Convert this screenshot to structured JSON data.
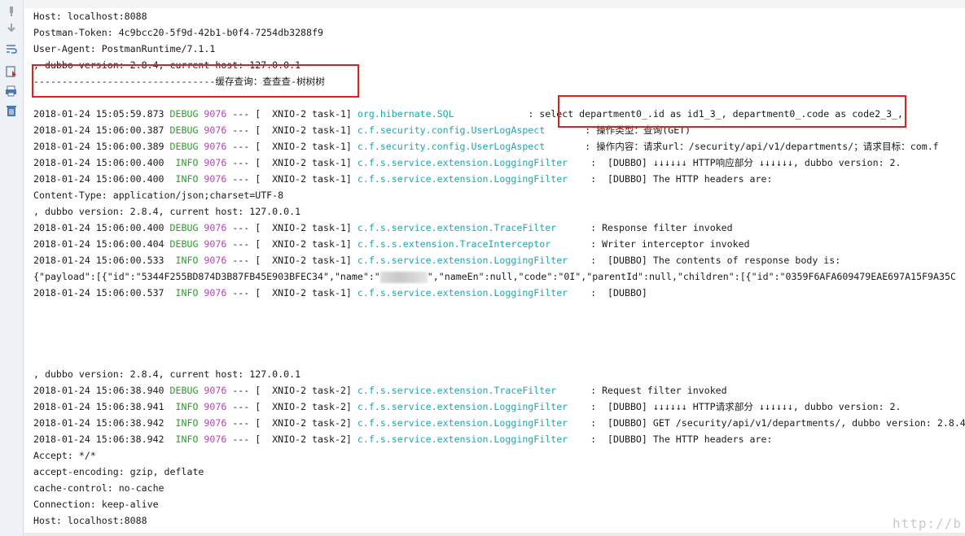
{
  "toolbar": {
    "icons": [
      "pin-icon",
      "down-arrow-icon",
      "soft-wrap-icon",
      "scroll-to-end-icon",
      "print-icon",
      "clear-icon"
    ]
  },
  "lines": [
    {
      "text": "Host: localhost:8088"
    },
    {
      "text": "Postman-Token: 4c9bcc20-5f9d-42b1-b0f4-7254db3288f9"
    },
    {
      "text": "User-Agent: PostmanRuntime/7.1.1"
    },
    {
      "text": ", dubbo version: 2.8.4, current host: 127.0.0.1"
    },
    {
      "text": "--------------------------------缓存查询：查查查-树树树"
    },
    {
      "text": ""
    },
    {
      "ts": "2018-01-24 15:05:59.873",
      "level": "DEBUG",
      "pid": "9076",
      "thread": "--- [  XNIO-2 task-1]",
      "logger": "org.hibernate.SQL",
      "pad": "             ",
      "msg": ": select department0_.id as id1_3_, department0_.code as code2_3_,"
    },
    {
      "ts": "2018-01-24 15:06:00.387",
      "level": "DEBUG",
      "pid": "9076",
      "thread": "--- [  XNIO-2 task-1]",
      "logger": "c.f.security.config.UserLogAspect",
      "pad": "       ",
      "msg": ": 操作类型：查询(GET)"
    },
    {
      "ts": "2018-01-24 15:06:00.389",
      "level": "DEBUG",
      "pid": "9076",
      "thread": "--- [  XNIO-2 task-1]",
      "logger": "c.f.security.config.UserLogAspect",
      "pad": "       ",
      "msg": ": 操作内容：请求url：/security/api/v1/departments/；请求目标：com.f"
    },
    {
      "ts": "2018-01-24 15:06:00.400",
      "level": " INFO",
      "pid": "9076",
      "thread": "--- [  XNIO-2 task-1]",
      "logger": "c.f.s.service.extension.LoggingFilter",
      "pad": "    ",
      "msg": ":  [DUBBO] ↓↓↓↓↓↓ HTTP响应部分 ↓↓↓↓↓↓, dubbo version: 2."
    },
    {
      "ts": "2018-01-24 15:06:00.400",
      "level": " INFO",
      "pid": "9076",
      "thread": "--- [  XNIO-2 task-1]",
      "logger": "c.f.s.service.extension.LoggingFilter",
      "pad": "    ",
      "msg": ":  [DUBBO] The HTTP headers are:"
    },
    {
      "text": "Content-Type: application/json;charset=UTF-8"
    },
    {
      "text": ", dubbo version: 2.8.4, current host: 127.0.0.1"
    },
    {
      "ts": "2018-01-24 15:06:00.400",
      "level": "DEBUG",
      "pid": "9076",
      "thread": "--- [  XNIO-2 task-1]",
      "logger": "c.f.s.service.extension.TraceFilter",
      "pad": "      ",
      "msg": ": Response filter invoked"
    },
    {
      "ts": "2018-01-24 15:06:00.404",
      "level": "DEBUG",
      "pid": "9076",
      "thread": "--- [  XNIO-2 task-1]",
      "logger": "c.f.s.s.extension.TraceInterceptor",
      "pad": "       ",
      "msg": ": Writer interceptor invoked"
    },
    {
      "ts": "2018-01-24 15:06:00.533",
      "level": " INFO",
      "pid": "9076",
      "thread": "--- [  XNIO-2 task-1]",
      "logger": "c.f.s.service.extension.LoggingFilter",
      "pad": "    ",
      "msg": ":  [DUBBO] The contents of response body is:"
    },
    {
      "json_pre": "{\"payload\":[{\"id\":\"5344F255BD874D3B87FB45E903BFEC34\",\"name\":\"",
      "json_post": "\",\"nameEn\":null,\"code\":\"0I\",\"parentId\":null,\"children\":[{\"id\":\"0359F6AFA609479EAE697A15F9A35C"
    },
    {
      "ts": "2018-01-24 15:06:00.537",
      "level": " INFO",
      "pid": "9076",
      "thread": "--- [  XNIO-2 task-1]",
      "logger": "c.f.s.service.extension.LoggingFilter",
      "pad": "    ",
      "msg": ":  [DUBBO]"
    },
    {
      "text": ""
    },
    {
      "text": ""
    },
    {
      "text": ""
    },
    {
      "text": ""
    },
    {
      "text": ", dubbo version: 2.8.4, current host: 127.0.0.1"
    },
    {
      "ts": "2018-01-24 15:06:38.940",
      "level": "DEBUG",
      "pid": "9076",
      "thread": "--- [  XNIO-2 task-2]",
      "logger": "c.f.s.service.extension.TraceFilter",
      "pad": "      ",
      "msg": ": Request filter invoked"
    },
    {
      "ts": "2018-01-24 15:06:38.941",
      "level": " INFO",
      "pid": "9076",
      "thread": "--- [  XNIO-2 task-2]",
      "logger": "c.f.s.service.extension.LoggingFilter",
      "pad": "    ",
      "msg": ":  [DUBBO] ↓↓↓↓↓↓ HTTP请求部分 ↓↓↓↓↓↓, dubbo version: 2."
    },
    {
      "ts": "2018-01-24 15:06:38.942",
      "level": " INFO",
      "pid": "9076",
      "thread": "--- [  XNIO-2 task-2]",
      "logger": "c.f.s.service.extension.LoggingFilter",
      "pad": "    ",
      "msg": ":  [DUBBO] GET /security/api/v1/departments/, dubbo version: 2.8.4"
    },
    {
      "ts": "2018-01-24 15:06:38.942",
      "level": " INFO",
      "pid": "9076",
      "thread": "--- [  XNIO-2 task-2]",
      "logger": "c.f.s.service.extension.LoggingFilter",
      "pad": "    ",
      "msg": ":  [DUBBO] The HTTP headers are:"
    },
    {
      "text": "Accept: */*"
    },
    {
      "text": "accept-encoding: gzip, deflate"
    },
    {
      "text": "cache-control: no-cache"
    },
    {
      "text": "Connection: keep-alive"
    },
    {
      "text": "Host: localhost:8088"
    }
  ],
  "watermark": "http://b",
  "colors": {
    "level": "#2d9b2d",
    "pid": "#b347b3",
    "logger": "#1aa7b3",
    "highlight_box": "#e02020"
  }
}
